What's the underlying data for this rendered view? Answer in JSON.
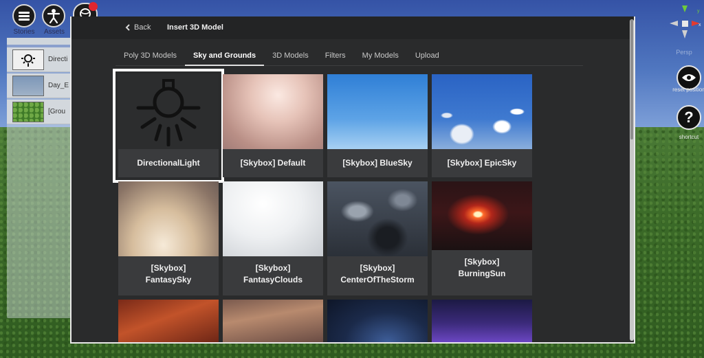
{
  "toolbar": {
    "stories_label": "Stories",
    "assets_label": "Assets"
  },
  "outliner": {
    "items": [
      {
        "label": "Directi",
        "icon": "bulb-icon"
      },
      {
        "label": "Day_E",
        "icon": "sky-thumb"
      },
      {
        "label": "[Grou",
        "icon": "grass-thumb"
      }
    ]
  },
  "viewport": {
    "persp_label": "Persp",
    "reset_label": "reset position",
    "shortcut_label": "shortcut"
  },
  "modal": {
    "back_label": "Back",
    "title": "Insert 3D Model",
    "tabs": [
      {
        "label": "Poly 3D Models",
        "active": false
      },
      {
        "label": "Sky and Grounds",
        "active": true
      },
      {
        "label": "3D Models",
        "active": false
      },
      {
        "label": "Filters",
        "active": false
      },
      {
        "label": "My Models",
        "active": false
      },
      {
        "label": "Upload",
        "active": false
      }
    ],
    "cards": [
      {
        "title": "DirectionalLight",
        "selected": true
      },
      {
        "title": "[Skybox] Default"
      },
      {
        "title": "[Skybox] BlueSky"
      },
      {
        "title": "[Skybox] EpicSky"
      },
      {
        "title_line1": "[Skybox]",
        "title_line2": "FantasySky"
      },
      {
        "title_line1": "[Skybox]",
        "title_line2": "FantasyClouds"
      },
      {
        "title_line1": "[Skybox]",
        "title_line2": "CenterOfTheStorm"
      },
      {
        "title_line1": "[Skybox]",
        "title_line2": "BurningSun"
      }
    ]
  },
  "colors": {
    "modal_bg": "#2a2b2c",
    "card_bg": "#3a3b3d",
    "selection": "#ffffff"
  }
}
